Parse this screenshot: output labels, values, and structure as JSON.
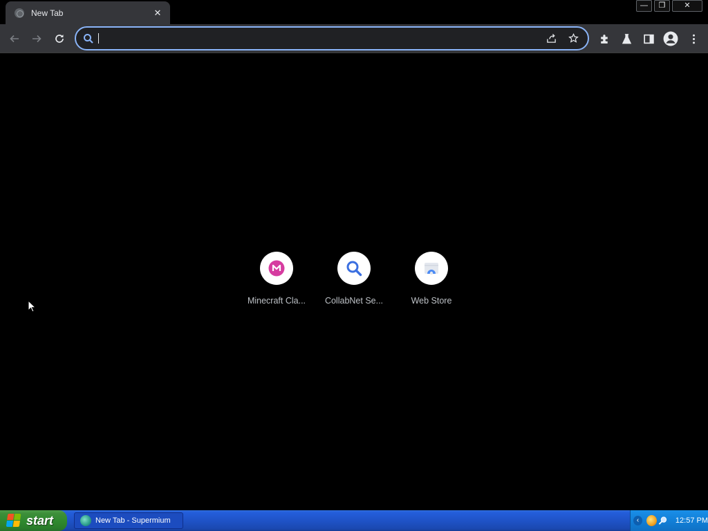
{
  "browser": {
    "tab": {
      "title": "New Tab",
      "close_glyph": "✕",
      "favicon": "globe-icon"
    },
    "window_controls": {
      "minimize": "—",
      "restore": "❐",
      "close": "✕"
    },
    "omnibox": {
      "value": "",
      "placeholder": "",
      "icon": "search-icon",
      "accent": "#8ab4f8"
    },
    "toolbar_icons": [
      "back-arrow-icon",
      "forward-arrow-icon",
      "reload-icon",
      "share-icon",
      "star-icon",
      "extensions-icon",
      "labs-flask-icon",
      "side-panel-icon",
      "profile-icon",
      "more-menu-icon"
    ]
  },
  "new_tab": {
    "shortcuts": [
      {
        "label": "Minecraft Cla...",
        "icon": "minecraft-classic-icon",
        "color": "#d63ca0"
      },
      {
        "label": "CollabNet Se...",
        "icon": "collabnet-search-icon",
        "color": "#3b6fe0"
      },
      {
        "label": "Web Store",
        "icon": "web-store-icon",
        "color": "#4a8af4"
      }
    ]
  },
  "taskbar": {
    "start_label": "start",
    "task_item_label": "New Tab - Supermium",
    "tray_arrow": "‹",
    "clock": "12:57 PM"
  }
}
